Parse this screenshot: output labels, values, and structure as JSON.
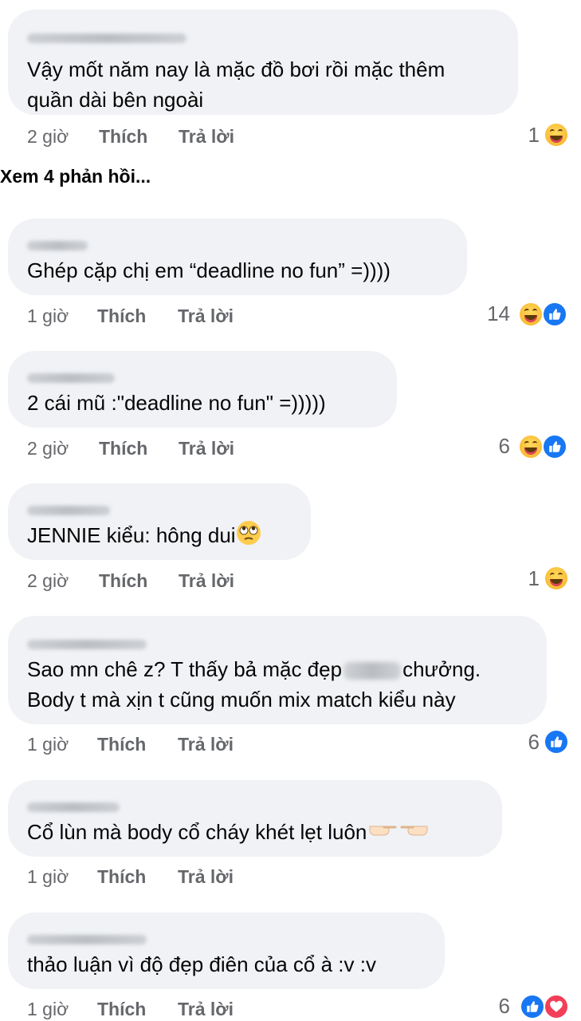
{
  "view_more": "Xem 4 phản hồi...",
  "comments": [
    {
      "lines": [
        "Vậy mốt năm nay là mặc đồ bơi rồi mặc thêm",
        "quần dài bên ngoài"
      ],
      "time": "2 giờ",
      "like": "Thích",
      "reply": "Trả lời",
      "count": "1",
      "reactions": [
        "haha"
      ]
    },
    {
      "lines": [
        "Ghép cặp chị em “deadline no fun” =))))"
      ],
      "time": "1 giờ",
      "like": "Thích",
      "reply": "Trả lời",
      "count": "14",
      "reactions": [
        "haha",
        "like"
      ]
    },
    {
      "lines": [
        "2 cái mũ :\"deadline no fun\" =)))))"
      ],
      "time": "2 giờ",
      "like": "Thích",
      "reply": "Trả lời",
      "count": "6",
      "reactions": [
        "haha",
        "like"
      ]
    },
    {
      "lines": [
        "JENNIE kiểu: hông dui"
      ],
      "time": "2 giờ",
      "like": "Thích",
      "reply": "Trả lời",
      "count": "1",
      "reactions": [
        "haha"
      ],
      "trailing_emoji": "face-with-rolling-eyes-icon"
    },
    {
      "lines": [
        "Sao mn chê z? T thấy bả mặc đẹp",
        "chưởng.",
        "Body t mà xịn t cũng muốn mix match kiểu này"
      ],
      "time": "1 giờ",
      "like": "Thích",
      "reply": "Trả lời",
      "count": "6",
      "reactions": [
        "like"
      ]
    },
    {
      "lines": [
        "Cổ lùn mà body cổ cháy khét lẹt luôn"
      ],
      "time": "1 giờ",
      "like": "Thích",
      "reply": "Trả lời",
      "trailing_emoji": "pointing-hands-icon"
    },
    {
      "lines": [
        "thảo luận vì độ đẹp điên của cổ à :v :v"
      ],
      "time": "1 giờ",
      "like": "Thích",
      "reply": "Trả lời",
      "count": "6",
      "reactions": [
        "like",
        "love"
      ]
    }
  ],
  "colors": {
    "bubble": "#f0f2f5",
    "meta_text": "#65676b",
    "like_blue": "#1877f2",
    "love_red": "#f33e58",
    "haha_yellow": "#f7b125"
  }
}
